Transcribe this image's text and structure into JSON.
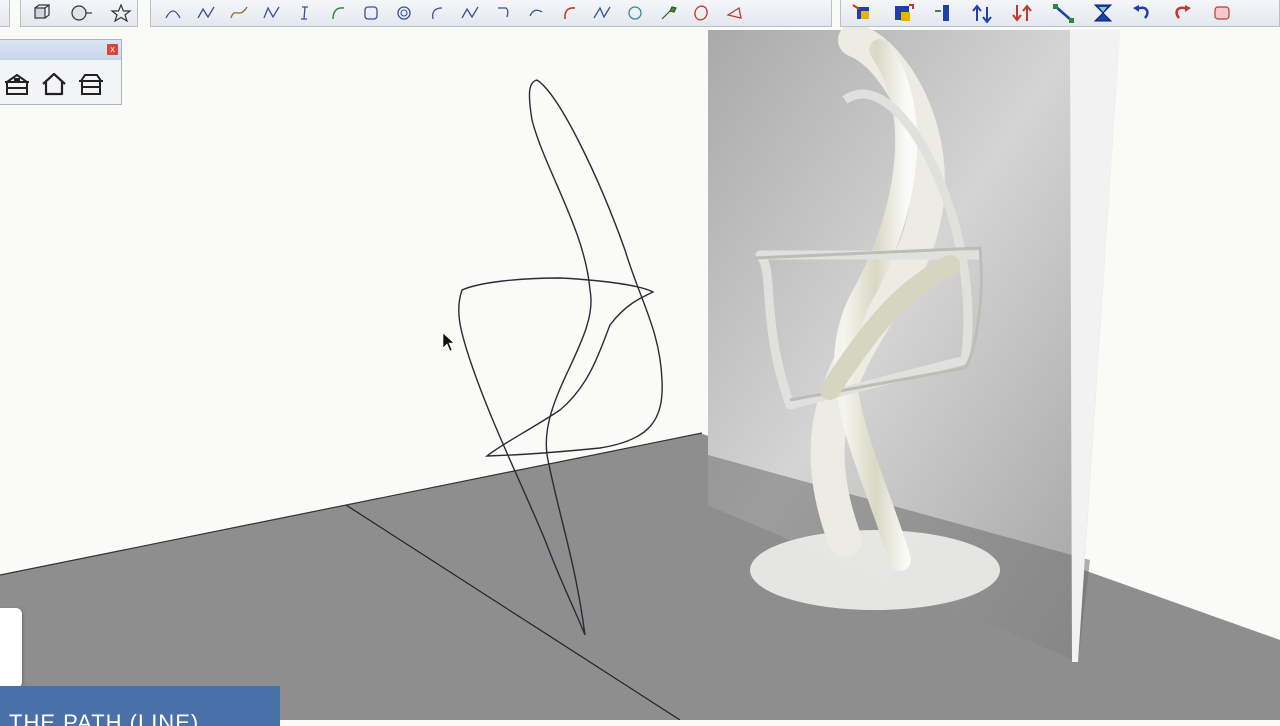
{
  "window": {
    "panel_close_label": "x"
  },
  "toolbars": {
    "group_a": [
      "cube-icon",
      "sphere-icon",
      "star-icon"
    ],
    "group_b": [
      "arc-icon",
      "zigzag-icon",
      "freehand-icon",
      "wave-icon",
      "i-curve-icon",
      "arc-open-icon",
      "rounded-rect-icon",
      "spiral-icon",
      "arc-left-icon",
      "zigzag2-icon",
      "hook-icon",
      "curve-icon",
      "red-arc-icon",
      "n-curve-icon",
      "circle-icon",
      "wrench-icon",
      "ellipse-icon",
      "lamp-icon"
    ],
    "group_c": [
      "move-cube-icon",
      "scale-cube-icon",
      "push-icon",
      "arrows-up-icon",
      "arrows-down-icon",
      "diagonal-icon",
      "hourglass-icon",
      "undo-icon",
      "redo-icon",
      "eraser-icon"
    ]
  },
  "panel": {
    "buttons": [
      "warehouse-icon",
      "house-icon",
      "shed-icon"
    ]
  },
  "viewport": {
    "colors": {
      "ground": "#8e8e8e",
      "wall": "#fafaf7",
      "path_line": "#2a2a3a",
      "render_panel": "#c8c8c8"
    }
  },
  "caption": {
    "text": "THE PATH (LINE)"
  }
}
